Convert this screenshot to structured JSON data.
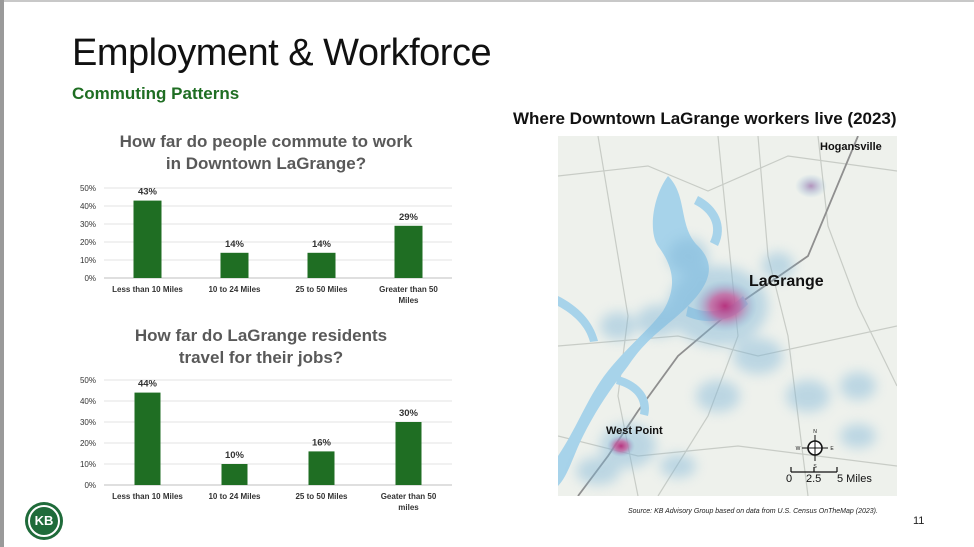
{
  "slide": {
    "title": "Employment & Workforce",
    "subtitle": "Commuting Patterns",
    "page_number": "11",
    "logo_text": "KB",
    "source": "Source: KB Advisory Group based on data from U.S. Census OnTheMap (2023)."
  },
  "map": {
    "title": "Where Downtown LaGrange workers live (2023)",
    "labels": {
      "hogansville": "Hogansville",
      "lagrange": "LaGrange",
      "west_point": "West Point"
    },
    "compass": {
      "n": "N",
      "s": "S",
      "e": "E",
      "w": "W"
    },
    "scale": {
      "zero": "0",
      "mid": "2.5",
      "end": "5 Miles"
    },
    "colors": {
      "water": "#a7d3ea",
      "land": "#eef1ec",
      "hot": "#c2357e"
    }
  },
  "chart_data": [
    {
      "type": "bar",
      "title": "How far do people commute to work in Downtown LaGrange?",
      "title_lines": [
        "How far do people commute to work",
        "in Downtown LaGrange?"
      ],
      "categories": [
        "Less than 10 Miles",
        "10 to 24 Miles",
        "25 to 50 Miles",
        "Greater than 50 Miles"
      ],
      "category_lines": [
        [
          "Less than 10 Miles"
        ],
        [
          "10 to 24 Miles"
        ],
        [
          "25 to 50 Miles"
        ],
        [
          "Greater than 50",
          "Miles"
        ]
      ],
      "values": [
        43,
        14,
        14,
        29
      ],
      "data_labels": [
        "43%",
        "14%",
        "14%",
        "29%"
      ],
      "ylim": [
        0,
        50
      ],
      "yticks": [
        0,
        10,
        20,
        30,
        40,
        50
      ],
      "ytick_labels": [
        "0%",
        "10%",
        "20%",
        "30%",
        "40%",
        "50%"
      ],
      "grid": true,
      "bar_color": "#1f6e23"
    },
    {
      "type": "bar",
      "title": "How far do LaGrange residents travel for their jobs?",
      "title_lines": [
        "How far do LaGrange residents",
        "travel for their jobs?"
      ],
      "categories": [
        "Less than 10 Miles",
        "10 to 24 Miles",
        "25 to 50 Miles",
        "Geater than 50 miles"
      ],
      "category_lines": [
        [
          "Less than 10 Miles"
        ],
        [
          "10 to 24 Miles"
        ],
        [
          "25 to 50 Miles"
        ],
        [
          "Geater than 50",
          "miles"
        ]
      ],
      "values": [
        44,
        10,
        16,
        30
      ],
      "data_labels": [
        "44%",
        "10%",
        "16%",
        "30%"
      ],
      "ylim": [
        0,
        50
      ],
      "yticks": [
        0,
        10,
        20,
        30,
        40,
        50
      ],
      "ytick_labels": [
        "0%",
        "10%",
        "20%",
        "30%",
        "40%",
        "50%"
      ],
      "grid": true,
      "bar_color": "#1f6e23"
    }
  ]
}
